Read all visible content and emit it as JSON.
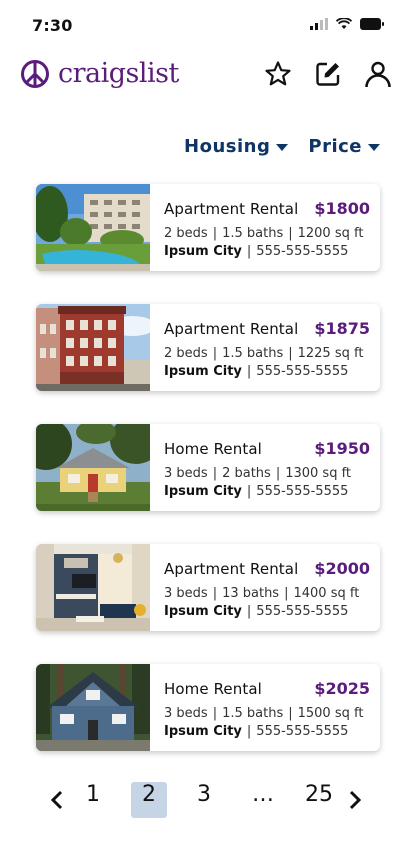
{
  "status": {
    "time": "7:30"
  },
  "header": {
    "logo_text": "craigslist",
    "icons": [
      "star-icon",
      "edit-icon",
      "user-icon"
    ]
  },
  "filters": [
    {
      "label": "Housing"
    },
    {
      "label": "Price"
    }
  ],
  "listings": [
    {
      "type": "Apartment Rental",
      "price": "$1800",
      "beds": "2 beds",
      "baths": "1.5 baths",
      "sqft": "1200 sq ft",
      "city": "Ipsum City",
      "phone": "555-555-5555",
      "image": "apartment-pool-photo"
    },
    {
      "type": "Apartment Rental",
      "price": "$1875",
      "beds": "2 beds",
      "baths": "1.5 baths",
      "sqft": "1225 sq ft",
      "city": "Ipsum City",
      "phone": "555-555-5555",
      "image": "brick-apartment-photo"
    },
    {
      "type": "Home Rental",
      "price": "$1950",
      "beds": "3 beds",
      "baths": "2 baths",
      "sqft": "1300 sq ft",
      "city": "Ipsum City",
      "phone": "555-555-5555",
      "image": "yellow-house-photo"
    },
    {
      "type": "Apartment Rental",
      "price": "$2000",
      "beds": "3 beds",
      "baths": "13 baths",
      "sqft": "1400 sq ft",
      "city": "Ipsum City",
      "phone": "555-555-5555",
      "image": "living-room-photo"
    },
    {
      "type": "Home Rental",
      "price": "$2025",
      "beds": "3 beds",
      "baths": "1.5 baths",
      "sqft": "1500 sq ft",
      "city": "Ipsum City",
      "phone": "555-555-5555",
      "image": "blue-house-photo"
    }
  ],
  "pagination": {
    "pages": [
      "1",
      "2",
      "3",
      "…",
      "25"
    ],
    "current": "2"
  },
  "colors": {
    "brand": "#5a1d7c",
    "filter_text": "#0e3566",
    "active_page_bg": "#c5d5e6"
  }
}
